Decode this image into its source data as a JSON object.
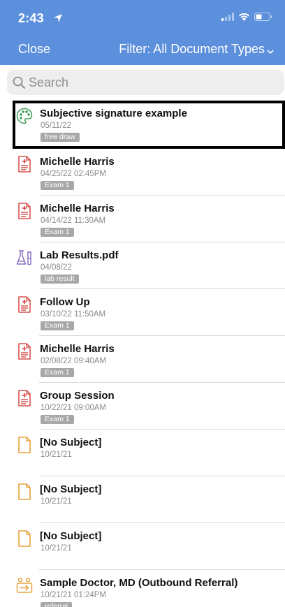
{
  "status_bar": {
    "time": "2:43"
  },
  "nav": {
    "close_label": "Close",
    "filter_label": "Filter: All Document Types"
  },
  "search": {
    "placeholder": "Search"
  },
  "colors": {
    "header": "#5c8fdc",
    "doc_red": "#d9534f",
    "orange": "#e7a23d",
    "lab_purple": "#8a6fc4",
    "palette_green": "#3e9e5a"
  },
  "documents": [
    {
      "icon": "palette-icon",
      "title": "Subjective signature example",
      "date": "05/11/22",
      "tag": "free draw",
      "selected": true
    },
    {
      "icon": "medical-document-icon",
      "title": "Michelle Harris",
      "date": "04/25/22 02:45PM",
      "tag": "Exam 1"
    },
    {
      "icon": "medical-document-icon",
      "title": "Michelle Harris",
      "date": "04/14/22 11:30AM",
      "tag": "Exam 1"
    },
    {
      "icon": "lab-flask-icon",
      "title": "Lab Results.pdf",
      "date": "04/08/22",
      "tag": "lab result"
    },
    {
      "icon": "medical-document-icon",
      "title": "Follow Up",
      "date": "03/10/22 11:50AM",
      "tag": "Exam 1"
    },
    {
      "icon": "medical-document-icon",
      "title": "Michelle Harris",
      "date": "02/08/22 09:40AM",
      "tag": "Exam 1"
    },
    {
      "icon": "medical-document-icon",
      "title": "Group Session",
      "date": "10/22/21 09:00AM",
      "tag": "Exam 1"
    },
    {
      "icon": "blank-document-icon",
      "title": "[No Subject]",
      "date": "10/21/21",
      "tag": ""
    },
    {
      "icon": "blank-document-icon",
      "title": "[No Subject]",
      "date": "10/21/21",
      "tag": ""
    },
    {
      "icon": "blank-document-icon",
      "title": "[No Subject]",
      "date": "10/21/21",
      "tag": ""
    },
    {
      "icon": "referral-icon",
      "title": "Sample Doctor, MD (Outbound Referral)",
      "date": "10/21/21 01:24PM",
      "tag": "referral"
    }
  ]
}
